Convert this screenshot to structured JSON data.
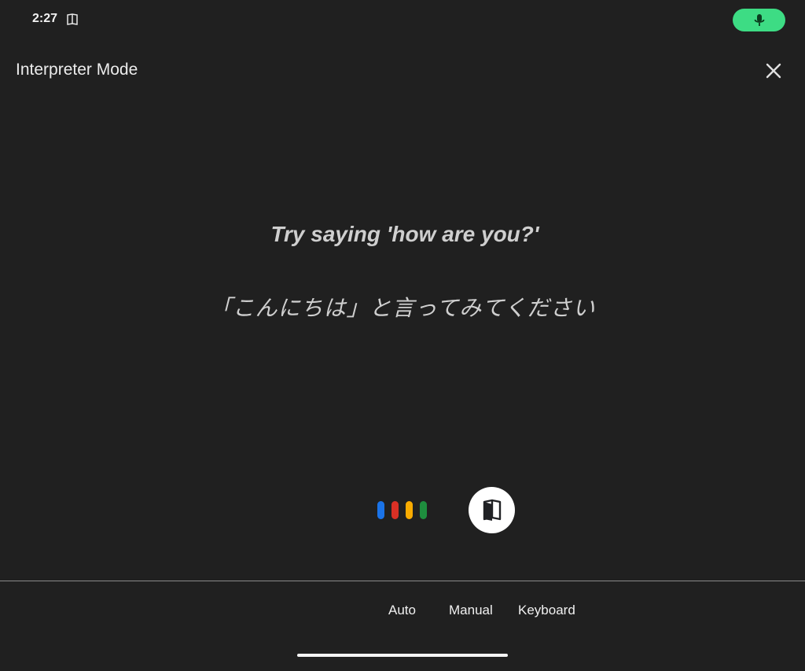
{
  "status_bar": {
    "time": "2:27",
    "book_icon": "book-open-icon",
    "mic_icon": "microphone-icon",
    "mic_pill_color": "#3ddc84"
  },
  "header": {
    "title": "Interpreter Mode",
    "close_icon": "close-icon"
  },
  "main": {
    "prompt_en": "Try saying 'how are you?'",
    "prompt_ja": "「こんにちは」と言ってみてください"
  },
  "controls": {
    "assistant_dots_colors": [
      "#1a73e8",
      "#d93025",
      "#f9ab00",
      "#1e8e3e"
    ],
    "book_button_icon": "book-open-icon"
  },
  "tabs": [
    {
      "label": "Auto"
    },
    {
      "label": "Manual"
    },
    {
      "label": "Keyboard"
    }
  ],
  "colors": {
    "background": "#202020",
    "text": "#ececec",
    "divider": "#8a8a8a"
  }
}
